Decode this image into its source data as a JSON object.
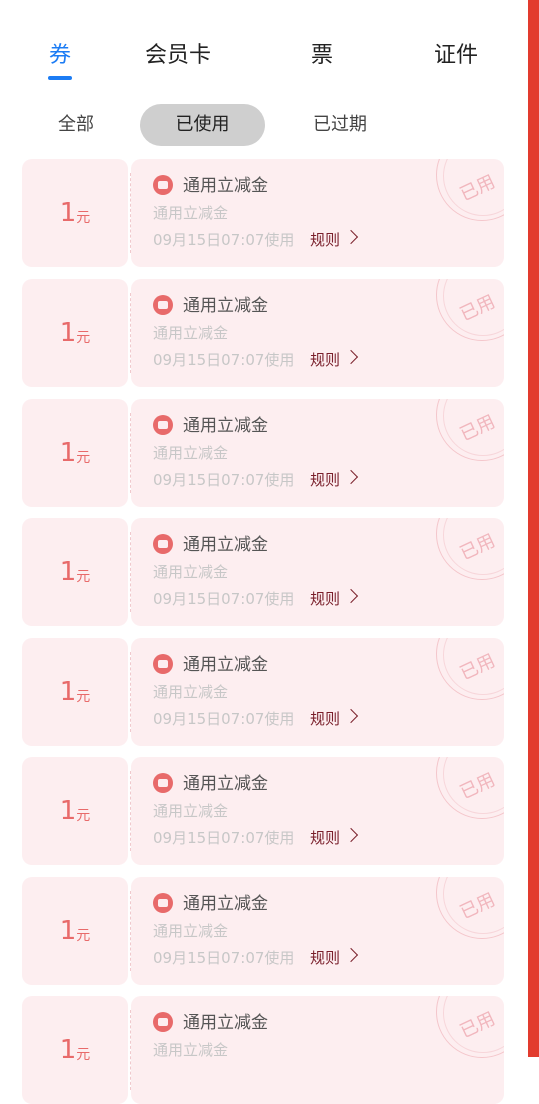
{
  "tabs": [
    {
      "label": "券",
      "active": true
    },
    {
      "label": "会员卡",
      "active": false
    },
    {
      "label": "票",
      "active": false
    },
    {
      "label": "证件",
      "active": false
    }
  ],
  "filters": [
    {
      "label": "全部",
      "active": false
    },
    {
      "label": "已使用",
      "active": true
    },
    {
      "label": "已过期",
      "active": false
    }
  ],
  "coupons": [
    {
      "amount": "1",
      "unit": "元",
      "title": "通用立减金",
      "subtitle": "通用立减金",
      "time": "09月15日07:07使用",
      "rules": "规则",
      "stamp": "已用"
    },
    {
      "amount": "1",
      "unit": "元",
      "title": "通用立减金",
      "subtitle": "通用立减金",
      "time": "09月15日07:07使用",
      "rules": "规则",
      "stamp": "已用"
    },
    {
      "amount": "1",
      "unit": "元",
      "title": "通用立减金",
      "subtitle": "通用立减金",
      "time": "09月15日07:07使用",
      "rules": "规则",
      "stamp": "已用"
    },
    {
      "amount": "1",
      "unit": "元",
      "title": "通用立减金",
      "subtitle": "通用立减金",
      "time": "09月15日07:07使用",
      "rules": "规则",
      "stamp": "已用"
    },
    {
      "amount": "1",
      "unit": "元",
      "title": "通用立减金",
      "subtitle": "通用立减金",
      "time": "09月15日07:07使用",
      "rules": "规则",
      "stamp": "已用"
    },
    {
      "amount": "1",
      "unit": "元",
      "title": "通用立减金",
      "subtitle": "通用立减金",
      "time": "09月15日07:07使用",
      "rules": "规则",
      "stamp": "已用"
    },
    {
      "amount": "1",
      "unit": "元",
      "title": "通用立减金",
      "subtitle": "通用立减金",
      "time": "09月15日07:07使用",
      "rules": "规则",
      "stamp": "已用"
    },
    {
      "amount": "1",
      "unit": "元",
      "title": "通用立减金",
      "subtitle": "通用立减金",
      "time": "",
      "rules": "",
      "stamp": "已用"
    }
  ],
  "icons": {
    "coupon_type": "red-envelope-icon",
    "rules_chevron": "chevron-right-icon"
  },
  "colors": {
    "accent": "#1c7cf4",
    "coupon_bg": "#fdeef0",
    "amount": "#e86a6a",
    "rules": "#7a1f2b",
    "scrollbar": "#e23b2e"
  }
}
